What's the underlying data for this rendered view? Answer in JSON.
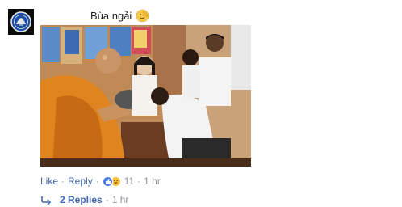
{
  "comment": {
    "text": "Bùa ngải",
    "emoji_icon": "facepalm-emoji-icon",
    "avatar_icon": "chelsea-crest-icon"
  },
  "actions": {
    "like_label": "Like",
    "reply_label": "Reply",
    "separator": "·",
    "reaction_icons": [
      "like-reaction-icon",
      "haha-reaction-icon"
    ],
    "reaction_count": "11",
    "timestamp": "1 hr"
  },
  "replies": {
    "arrow_icon": "reply-arrow-icon",
    "label": "2 Replies",
    "separator": "·",
    "timestamp": "1 hr"
  },
  "colors": {
    "link": "#4267b2",
    "meta": "#90949c",
    "text": "#1c1e21",
    "like_reaction": "#4c7ce8",
    "haha_reaction": "#f7c23a"
  }
}
